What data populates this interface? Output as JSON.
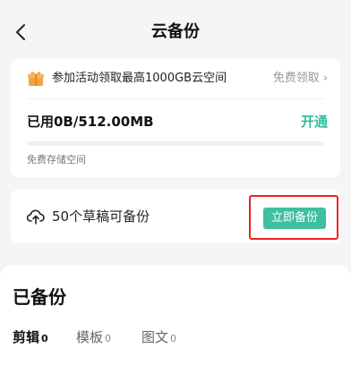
{
  "header": {
    "title": "云备份"
  },
  "promo": {
    "text": "参加活动领取最高1000GB云空间",
    "link": "免费领取"
  },
  "storage": {
    "used_text": "已用0B/512.00MB",
    "open_label": "开通",
    "progress": 0,
    "free_label": "免费存储空间"
  },
  "backup": {
    "drafts_text": "50个草稿可备份",
    "button_label": "立即备份"
  },
  "backed_up": {
    "title": "已备份",
    "tabs": [
      {
        "label": "剪辑",
        "count": "0"
      },
      {
        "label": "模板",
        "count": "0"
      },
      {
        "label": "图文",
        "count": "0"
      }
    ]
  },
  "colors": {
    "accent": "#2dbd9c",
    "highlight": "#e22222"
  }
}
